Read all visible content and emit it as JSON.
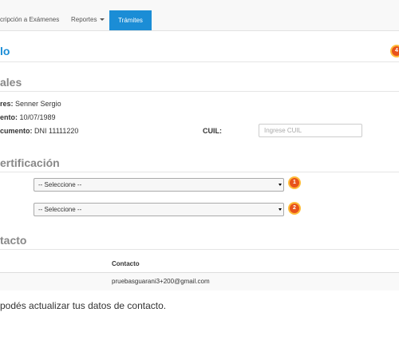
{
  "nav": {
    "tab_inscripcion": "cripción a Exámenes",
    "tab_reportes": "Reportes",
    "tab_tramites": "Trámites"
  },
  "page": {
    "title": "lo",
    "badge_top": "4"
  },
  "datos": {
    "heading": "ales",
    "nombres_label": "res:",
    "nombres_value": "Senner Sergio",
    "nacimiento_label": "ento:",
    "nacimiento_value": "10/07/1989",
    "documento_label": "cumento:",
    "documento_value": "DNI 11111220",
    "cuil_label": "CUIL:",
    "cuil_placeholder": "Ingrese CUIL"
  },
  "certificacion": {
    "heading": "ertificación",
    "select1_value": "-- Seleccione --",
    "select2_value": "-- Seleccione --",
    "badge1": "1",
    "badge2": "2"
  },
  "contacto": {
    "heading": "tacto",
    "column_header": "Contacto",
    "rows": [
      "pruebasguarani3+200@gmail.com"
    ],
    "note": "podés actualizar tus datos de contacto."
  },
  "colors": {
    "accent": "#1b8dd6",
    "badge": "#e8531a"
  }
}
